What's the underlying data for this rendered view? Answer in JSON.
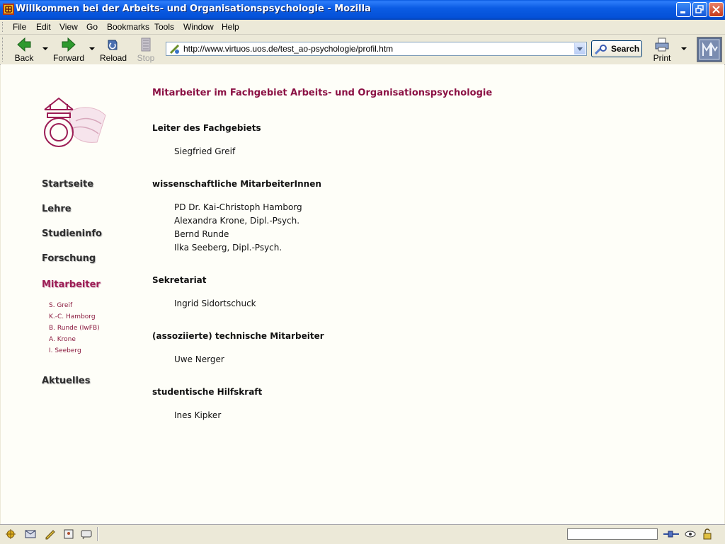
{
  "window": {
    "title": "Willkommen bei der Arbeits- und Organisationspsychologie - Mozilla"
  },
  "menu": [
    "File",
    "Edit",
    "View",
    "Go",
    "Bookmarks",
    "Tools",
    "Window",
    "Help"
  ],
  "toolbar": {
    "back": "Back",
    "forward": "Forward",
    "reload": "Reload",
    "stop": "Stop",
    "url": "http://www.virtuos.uos.de/test_ao-psychologie/profil.htm",
    "search": "Search",
    "print": "Print"
  },
  "sidebar": {
    "nav": [
      "Startseite",
      "Lehre",
      "Studieninfo",
      "Forschung",
      "Mitarbeiter",
      "Aktuelles"
    ],
    "active": "Mitarbeiter",
    "sub": [
      "S. Greif",
      "K.-C. Hamborg",
      "B. Runde (IwFB)",
      "A. Krone",
      "I. Seeberg"
    ]
  },
  "page": {
    "heading": "Mitarbeiter im Fachgebiet Arbeits- und Organisationspsychologie",
    "sections": [
      {
        "title": "Leiter des Fachgebiets",
        "people": [
          "Siegfried Greif"
        ]
      },
      {
        "title": "wissenschaftliche MitarbeiterInnen",
        "people": [
          "PD Dr. Kai-Christoph Hamborg",
          "Alexandra Krone, Dipl.-Psych.",
          "Bernd Runde",
          "Ilka Seeberg, Dipl.-Psych."
        ]
      },
      {
        "title": "Sekretariat",
        "people": [
          "Ingrid Sidortschuck"
        ]
      },
      {
        "title": "(assoziierte) technische Mitarbeiter",
        "people": [
          "Uwe Nerger"
        ]
      },
      {
        "title": "studentische Hilfskraft",
        "people": [
          "Ines Kipker"
        ]
      }
    ]
  },
  "colors": {
    "heading": "#8b1144",
    "active_nav": "#9c1d55",
    "sub_nav": "#8a1a3e",
    "page_bg": "#fefef8"
  }
}
